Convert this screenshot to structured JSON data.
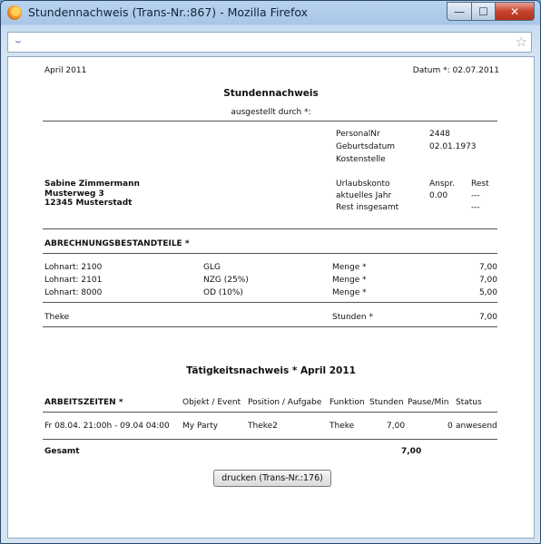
{
  "window": {
    "title": "Stundennachweis (Trans-Nr.:867) - Mozilla Firefox"
  },
  "page": {
    "month": "April 2011",
    "date": "Datum *: 02.07.2011",
    "heading": "Stundennachweis",
    "issued_by": "ausgestellt durch *:",
    "employee": {
      "personal_label": "PersonalNr",
      "personal_value": "2448",
      "birth_label": "Geburtsdatum",
      "birth_value": "02.01.1973",
      "cost_label": "Kostenstelle",
      "name": "Sabine Zimmermann",
      "street": "Musterweg 3",
      "city": "12345 Musterstadt"
    },
    "vacation": {
      "label": "Urlaubskonto",
      "col_claim": "Anspr.",
      "col_rest": "Rest",
      "current_label": "aktuelles Jahr",
      "current_claim": "0.00",
      "current_rest": "---",
      "total_label": "Rest insgesamt",
      "total_rest": "---"
    },
    "billing": {
      "title": "ABRECHNUNGSBESTANDTEILE *",
      "rows": [
        {
          "lohnart": "Lohnart: 2100",
          "code": "GLG",
          "label": "Menge *",
          "value": "7,00"
        },
        {
          "lohnart": "Lohnart: 2101",
          "code": "NZG (25%)",
          "label": "Menge *",
          "value": "7,00"
        },
        {
          "lohnart": "Lohnart: 8000",
          "code": "OD (10%)",
          "label": "Menge *",
          "value": "5,00"
        }
      ],
      "theke_label": "Theke",
      "hours_label": "Stunden *",
      "hours_value": "7,00"
    },
    "activity": {
      "title": "Tätigkeitsnachweis * April 2011",
      "headers": {
        "worktime": "ARBEITSZEITEN *",
        "object": "Objekt / Event",
        "position": "Position / Aufgabe",
        "function": "Funktion",
        "hours": "Stunden",
        "pause": "Pause/Min",
        "status": "Status"
      },
      "row": {
        "worktime": "Fr 08.04. 21:00h - 09.04 04:00",
        "object": "My Party",
        "position": "Theke2",
        "function": "Theke",
        "hours": "7,00",
        "pause": "0",
        "status": "anwesend"
      },
      "total_label": "Gesamt",
      "total_value": "7,00"
    },
    "print_button": "drucken (Trans-Nr.:176)"
  }
}
